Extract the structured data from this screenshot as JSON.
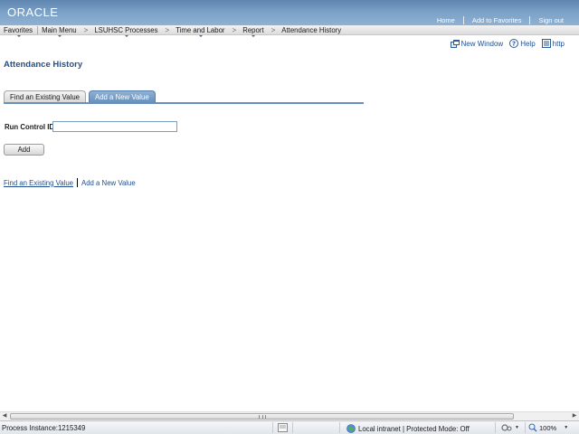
{
  "header": {
    "logo": "ORACLE",
    "links": [
      "Home",
      "Add to Favorites",
      "Sign out"
    ]
  },
  "menubar": {
    "favorites": "Favorites",
    "main_menu": "Main Menu",
    "crumbs": [
      "LSUHSC Processes",
      "Time and Labor",
      "Report",
      "Attendance History"
    ]
  },
  "pagebar": {
    "new_window": "New Window",
    "help": "Help",
    "http": "http"
  },
  "page": {
    "title": "Attendance History",
    "tabs": [
      {
        "label": "Find an Existing Value",
        "active": false
      },
      {
        "label": "Add a New Value",
        "active": true
      }
    ],
    "run_control_label": "Run Control ID:",
    "run_control_value": "",
    "add_button": "Add",
    "bottom_links": [
      "Find an Existing Value",
      "Add a New Value"
    ]
  },
  "statusbar": {
    "process_instance": "Process Instance:1215349",
    "zone": "Local intranet | Protected Mode: Off",
    "zoom": "100%"
  },
  "colors": {
    "banner": "#7da2c8",
    "link": "#1f4d8f",
    "title": "#284f86",
    "active_tab": "#7aa0c8"
  }
}
